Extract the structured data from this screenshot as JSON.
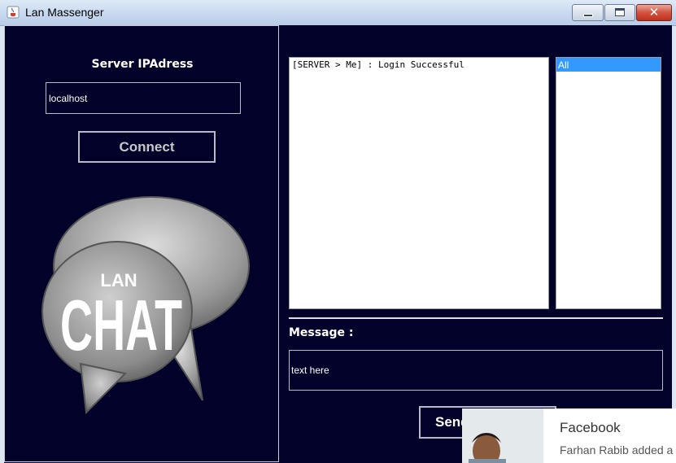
{
  "window": {
    "title": "Lan Massenger",
    "icon": "java-cup-icon",
    "controls": {
      "minimize": "minimize-icon",
      "maximize": "maximize-icon",
      "close": "✕"
    }
  },
  "left_panel": {
    "server_label": "Server IPAdress",
    "server_ip_value": "localhost",
    "connect_label": "Connect",
    "logo": {
      "top_text": "LAN",
      "main_text": "CHAT",
      "icon": "speech-bubbles-logo"
    }
  },
  "chat": {
    "log": "[SERVER > Me] : Login Successful",
    "users": [
      "All"
    ],
    "selected_user": "All",
    "message_label": "Message :",
    "message_value": "text here",
    "send_label": "Send"
  },
  "notification": {
    "app": "Facebook",
    "text": "Farhan Rabib added a"
  },
  "colors": {
    "background": "#02012a",
    "selection": "#3399ff"
  }
}
